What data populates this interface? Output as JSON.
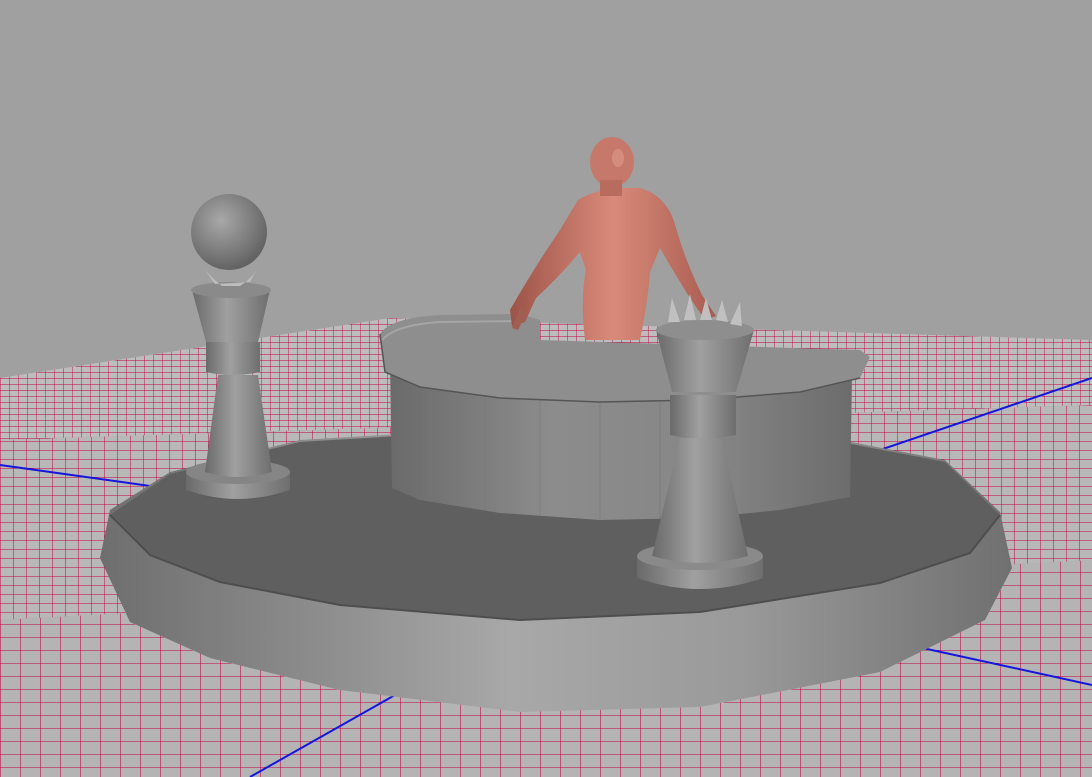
{
  "viewport": {
    "kind": "3d-modeling-viewport",
    "shading": "smooth-shaded",
    "colors": {
      "background": "#a0a0a0",
      "grid_lines": "#c4003f",
      "grid_axis": "#1515dd",
      "model_gray": "#7c7c7c",
      "figure_skin": "#c6786a"
    }
  },
  "scene": {
    "objects": [
      "ground-grid",
      "round-base-platform",
      "curved-counter-desk",
      "human-figure",
      "left-pillar-with-sphere",
      "right-pillar-with-spiked-crown"
    ]
  }
}
